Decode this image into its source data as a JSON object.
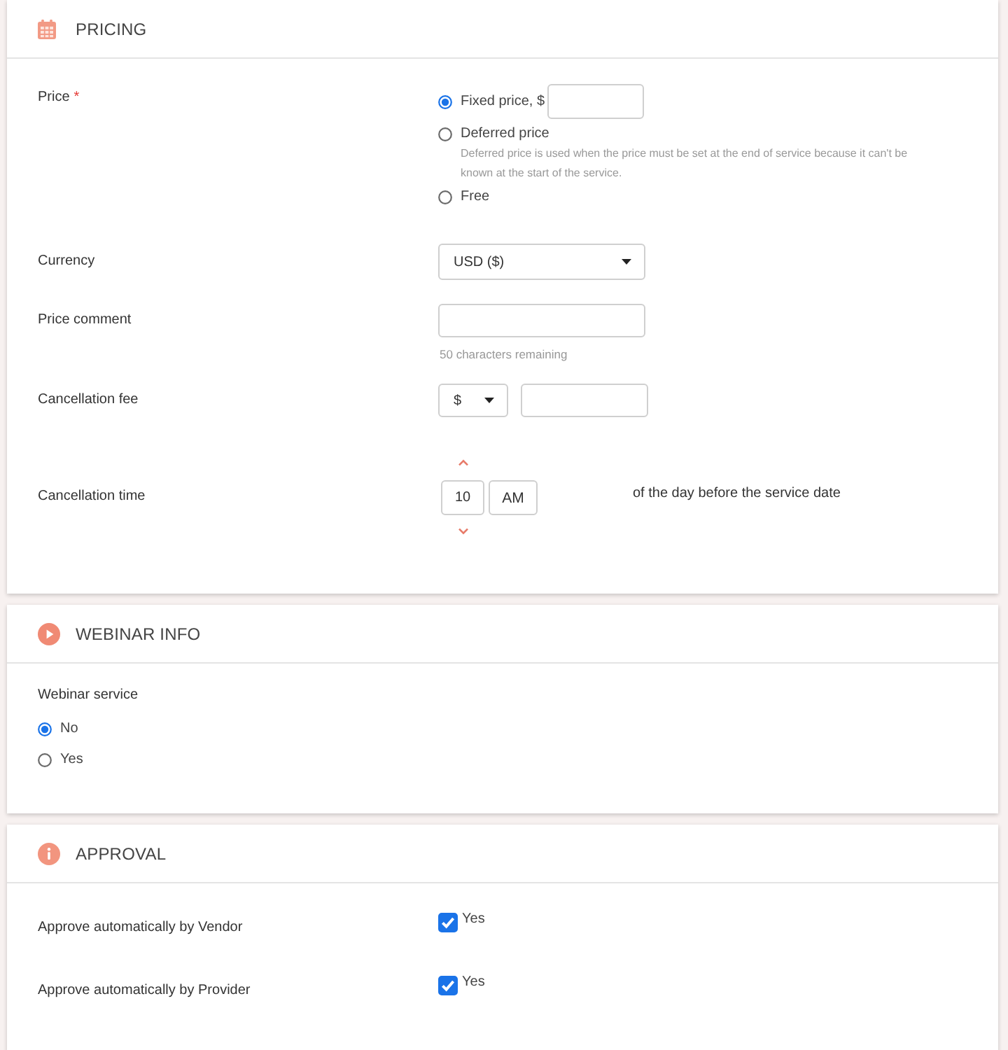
{
  "sections": [
    {
      "title": "PRICING",
      "fields": [
        {
          "kind": "price_options",
          "label": "Price",
          "required_mark": "*",
          "options": [
            {
              "label": "Fixed price, $",
              "selected": true,
              "kind": "amount"
            },
            {
              "label": "Deferred price",
              "selected": false,
              "kind": "plain",
              "hint": "Deferred price is used when the price must be set at the end of service because it can't be known at the start of the service."
            },
            {
              "label": "Free",
              "selected": false,
              "kind": "plain"
            }
          ]
        },
        {
          "kind": "select",
          "label": "Currency",
          "value": "USD ($)"
        },
        {
          "kind": "text",
          "label": "Price comment",
          "hint": "50 characters remaining"
        },
        {
          "kind": "fee",
          "label": "Cancellation fee",
          "unit": "$"
        },
        {
          "kind": "time",
          "label": "Cancellation time",
          "hour": "10",
          "period": "AM",
          "suffix": "of the day before the service date"
        }
      ]
    },
    {
      "title": "WEBINAR INFO",
      "fields": [
        {
          "kind": "radio_stack",
          "label": "Webinar service",
          "options": [
            {
              "label": "No",
              "selected": true
            },
            {
              "label": "Yes",
              "selected": false
            }
          ]
        }
      ]
    },
    {
      "title": "APPROVAL",
      "fields": [
        {
          "kind": "checkbox",
          "label": "Approve automatically by Vendor",
          "option": "Yes",
          "checked": true
        },
        {
          "kind": "checkbox",
          "label": "Approve automatically by Provider",
          "option": "Yes",
          "checked": true
        }
      ]
    }
  ]
}
